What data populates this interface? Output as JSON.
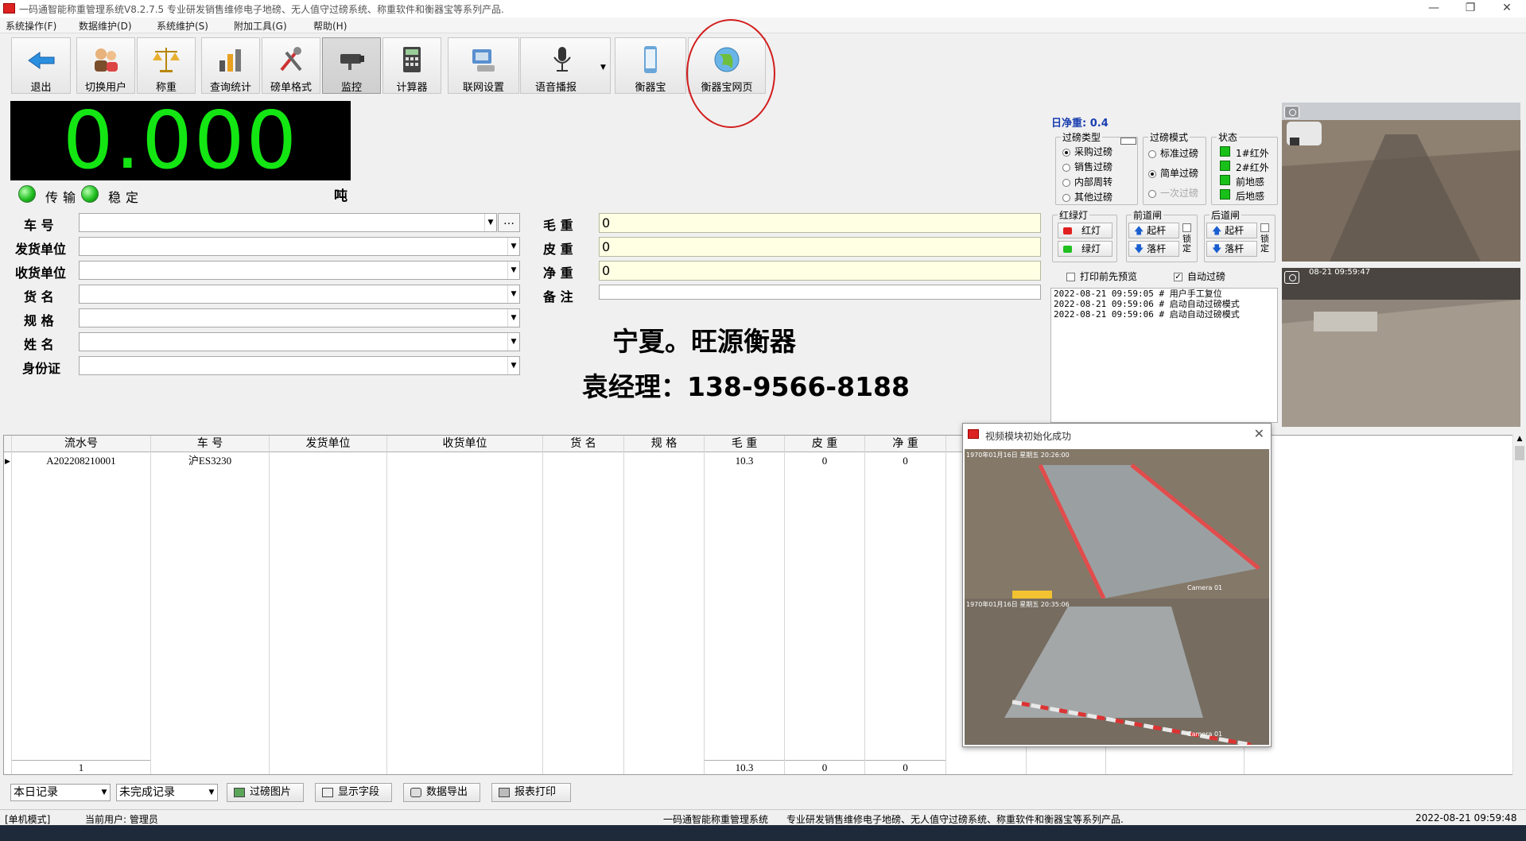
{
  "window": {
    "title": "一码通智能称重管理系统V8.2.7.5  专业研发销售维修电子地磅、无人值守过磅系统、称重软件和衡器宝等系列产品.",
    "controls": [
      "—",
      "❐",
      "✕"
    ]
  },
  "menu": [
    "系统操作(F)",
    "数据维护(D)",
    "系统维护(S)",
    "附加工具(G)",
    "帮助(H)"
  ],
  "toolbar": [
    {
      "label": "退出",
      "icon": "exit-arrow-icon"
    },
    {
      "label": "切换用户",
      "icon": "switch-user-icon"
    },
    {
      "label": "称重",
      "icon": "balance-scale-icon"
    },
    {
      "label": "查询统计",
      "icon": "statistics-icon"
    },
    {
      "label": "磅单格式",
      "icon": "tools-icon"
    },
    {
      "label": "监控",
      "icon": "surveillance-camera-icon"
    },
    {
      "label": "计算器",
      "icon": "calculator-icon"
    },
    {
      "label": "联网设置",
      "icon": "network-icon"
    },
    {
      "label": "语音播报",
      "icon": "microphone-icon"
    },
    {
      "label": "衡器宝",
      "icon": "phone-icon"
    },
    {
      "label": "衡器宝网页",
      "icon": "globe-icon"
    }
  ],
  "weight": {
    "value": "0.000",
    "transfer_label": "传输",
    "stable_label": "稳定",
    "unit": "吨"
  },
  "form": {
    "fields": [
      {
        "label": "车  号",
        "value": ""
      },
      {
        "label": "发货单位",
        "value": ""
      },
      {
        "label": "收货单位",
        "value": ""
      },
      {
        "label": "货  名",
        "value": ""
      },
      {
        "label": "规  格",
        "value": ""
      },
      {
        "label": "姓  名",
        "value": ""
      },
      {
        "label": "身份证",
        "value": ""
      }
    ],
    "ellipsis": "…",
    "weights": [
      {
        "label": "毛 重",
        "value": "0"
      },
      {
        "label": "皮 重",
        "value": "0"
      },
      {
        "label": "净 重",
        "value": "0"
      },
      {
        "label": "备 注",
        "value": ""
      }
    ]
  },
  "company": {
    "name": "宁夏。旺源衡器",
    "contact": "袁经理：138-9566-8188"
  },
  "panel": {
    "daily_net": "日净重: 0.4",
    "weigh_type": {
      "title": "过磅类型",
      "options": [
        "采购过磅",
        "销售过磅",
        "内部周转",
        "其他过磅"
      ],
      "selected": 0
    },
    "weigh_mode": {
      "title": "过磅模式",
      "options": [
        "标准过磅",
        "简单过磅",
        "一次过磅"
      ],
      "selected": 1
    },
    "status": {
      "title": "状态",
      "items": [
        "1#红外",
        "2#红外",
        "前地感",
        "后地感"
      ]
    },
    "traffic": {
      "title": "红绿灯",
      "red": "红灯",
      "green": "绿灯"
    },
    "front_gate": {
      "title": "前道闸",
      "up": "起杆",
      "down": "落杆",
      "lock": "锁定"
    },
    "rear_gate": {
      "title": "后道闸",
      "up": "起杆",
      "down": "落杆",
      "lock": "锁定"
    },
    "print_preview": {
      "label": "打印前先预览",
      "checked": false
    },
    "auto_weigh": {
      "label": "自动过磅",
      "checked": true
    },
    "log": [
      "2022-08-21 09:59:05 # 用户手工复位",
      "2022-08-21 09:59:06 # 启动自动过磅模式",
      "2022-08-21 09:59:06 # 启动自动过磅模式"
    ],
    "camera2_timestamp": "08-21 09:59:47"
  },
  "grid": {
    "headers": [
      "流水号",
      "车  号",
      "发货单位",
      "收货单位",
      "货  名",
      "规  格",
      "毛  重",
      "皮  重",
      "净  重",
      "",
      "",
      ""
    ],
    "rows": [
      [
        "A202208210001",
        "沪ES3230",
        "",
        "",
        "",
        "",
        "10.3",
        "0",
        "0",
        "",
        "",
        ""
      ]
    ],
    "footer": [
      "1",
      "",
      "",
      "",
      "",
      "",
      "10.3",
      "0",
      "0",
      "",
      "",
      ""
    ]
  },
  "video_popup": {
    "title": "视频模块初始化成功",
    "close": "✕",
    "cam1_time": "1970年01月16日 星期五 20:26:00",
    "cam1_label": "Camera 01",
    "cam2_time": "1970年01月16日 星期五 20:35:06",
    "cam2_label": "Camera 01"
  },
  "bottom": {
    "filter1": "本日记录",
    "filter2": "未完成记录",
    "buttons": [
      "过磅图片",
      "显示字段",
      "数据导出",
      "报表打印"
    ]
  },
  "statusbar": {
    "mode": "[单机模式]",
    "user": "当前用户: 管理员",
    "product": "一码通智能称重管理系统",
    "slogan": "专业研发销售维修电子地磅、无人值守过磅系统、称重软件和衡器宝等系列产品.",
    "datetime": "2022-08-21 09:59:48"
  },
  "colors": {
    "weight_digits": "#13e613",
    "highlight": "#d21d1d",
    "daily_net": "#1a3fb0",
    "value_bg": "#ffffe4"
  }
}
